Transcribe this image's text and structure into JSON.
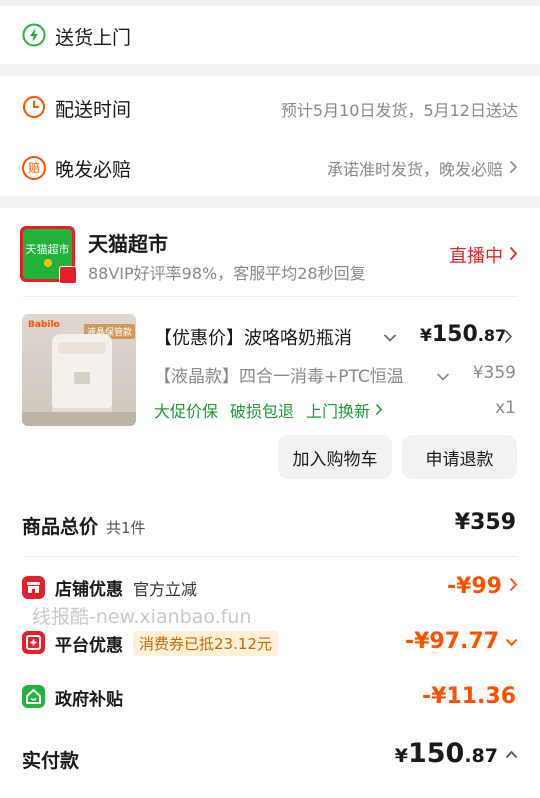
{
  "delivery": {
    "label": "送货上门"
  },
  "schedule": {
    "label": "配送时间",
    "value": "预计5月10日发货，5月12日送达"
  },
  "late_comp": {
    "icon_text": "赔",
    "label": "晚发必赔",
    "value": "承诺准时发货，晚发必赔"
  },
  "shop": {
    "name": "天猫超市",
    "logo_text": "天猫超市",
    "subtitle": "88VIP好评率98%，客服平均28秒回复",
    "live": "直播中"
  },
  "product": {
    "image_badge": "Babilo",
    "image_caption": "液晶保管款",
    "title": "【优惠价】波咯咯奶瓶消",
    "price_symbol": "¥",
    "price_int": "150",
    "price_dec": ".87",
    "variant": "【液晶款】四合一消毒+PTC恒温",
    "original_price": "¥359",
    "tags": [
      "大促价保",
      "破损包退",
      "上门换新"
    ],
    "quantity": "x1",
    "add_to_cart": "加入购物车",
    "refund": "申请退款"
  },
  "summary": {
    "total_label": "商品总价",
    "total_count": "共1件",
    "total_value": "¥359",
    "store_discount": {
      "label": "店铺优惠",
      "detail": "官方立减",
      "value": "-¥99"
    },
    "watermark": "线报酷-new.xianbao.fun",
    "platform_discount": {
      "label": "平台优惠",
      "detail": "消费券已抵23.12元",
      "value": "-¥97.77"
    },
    "gov_subsidy": {
      "label": "政府补贴",
      "value": "-¥11.36"
    },
    "paid": {
      "label": "实付款",
      "symbol": "¥",
      "int": "150",
      "dec": ".87"
    }
  },
  "colors": {
    "accent_orange": "#ff5000",
    "live_red": "#e0272f",
    "tag_green": "#1d9a3a",
    "icon_green": "#22b33a",
    "icon_red": "#e5202b"
  }
}
